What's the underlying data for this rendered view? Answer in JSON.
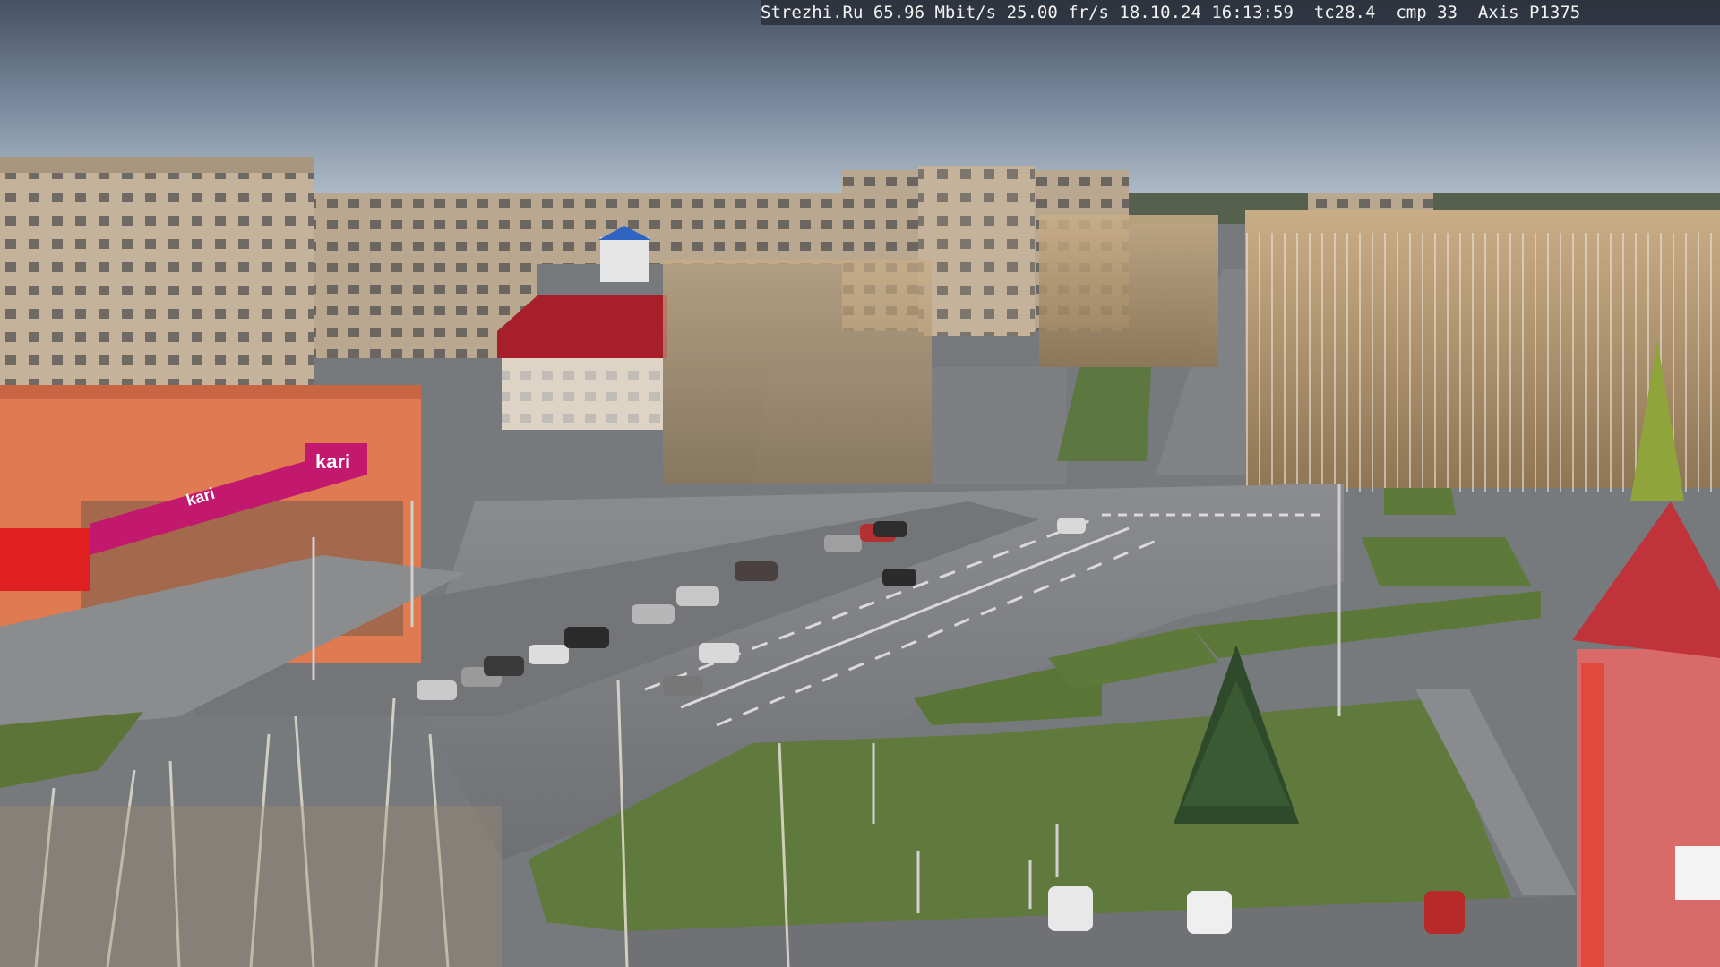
{
  "osd": {
    "site": "Strezhi.Ru",
    "bitrate": "65.96 Mbit/s",
    "fps": "25.00 fr/s",
    "datetime": "18.10.24 16:13:59",
    "tc": "tc28.4",
    "cmp": "cmp 33",
    "camera": "Axis P1375"
  },
  "signs": {
    "store_logo": "kari",
    "store_sub_logo": "kari"
  },
  "colors": {
    "sky_top": "#4a5566",
    "sky_horizon": "#a9b6c4",
    "asphalt": "#7a7b7e",
    "lawn": "#5f7a3c",
    "store_facade": "#e07a50",
    "store_banner": "#c2186e",
    "right_building": "#c83a3a"
  }
}
